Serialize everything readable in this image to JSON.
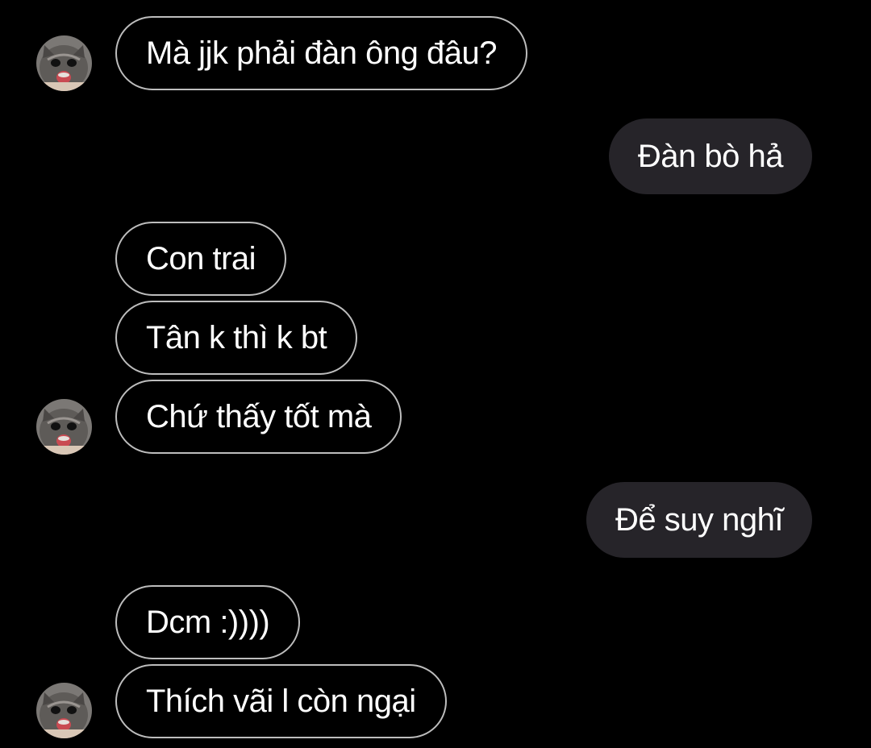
{
  "chat": {
    "messages": [
      {
        "sender": "other",
        "text": "Mà jjk phải đàn ông đâu?",
        "avatar": "cat-avatar"
      },
      {
        "sender": "self",
        "text": "Đàn bò hả"
      },
      {
        "sender": "other",
        "text": "Con trai"
      },
      {
        "sender": "other",
        "text": "Tân k thì k bt"
      },
      {
        "sender": "other",
        "text": "Chứ thấy tốt mà",
        "avatar": "cat-avatar"
      },
      {
        "sender": "self",
        "text": "Để suy nghĩ"
      },
      {
        "sender": "other",
        "text": "Dcm :))))"
      },
      {
        "sender": "other",
        "text": "Thích vãi l còn ngại",
        "avatar": "cat-avatar"
      }
    ]
  },
  "colors": {
    "background": "#000000",
    "incoming_border": "#bdbdbd",
    "outgoing_fill": "#262429",
    "text": "#ffffff"
  }
}
